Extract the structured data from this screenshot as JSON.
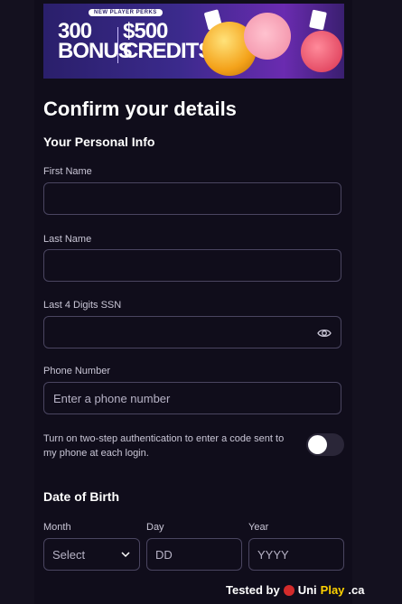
{
  "banner": {
    "ribbon": "NEW PLAYER PERKS",
    "offer_left": "300",
    "offer_left_sub": "BONUS",
    "offer_right": "$500",
    "offer_right_sub": "CREDITS"
  },
  "page": {
    "title": "Confirm your details",
    "section_personal": "Your Personal Info",
    "section_dob": "Date of Birth"
  },
  "fields": {
    "first_name_label": "First Name",
    "first_name_value": "",
    "last_name_label": "Last Name",
    "last_name_value": "",
    "ssn_label": "Last 4 Digits SSN",
    "ssn_value": "",
    "phone_label": "Phone Number",
    "phone_placeholder": "Enter a phone number"
  },
  "two_step": {
    "text": "Turn on two-step authentication to enter a code sent to my phone at each login.",
    "enabled": false
  },
  "dob": {
    "month_label": "Month",
    "month_value": "Select",
    "day_label": "Day",
    "day_placeholder": "DD",
    "year_label": "Year",
    "year_placeholder": "YYYY"
  },
  "footer": {
    "tested_by": "Tested by",
    "brand_uni": "Uni",
    "brand_play": "Play",
    "brand_tld": ".ca"
  },
  "icons": [
    "eye-icon",
    "chevron-down-icon",
    "maple-leaf-icon"
  ],
  "colors": {
    "background": "#100d1b",
    "border": "#4a4560",
    "toggle_off": "#2a2638"
  }
}
